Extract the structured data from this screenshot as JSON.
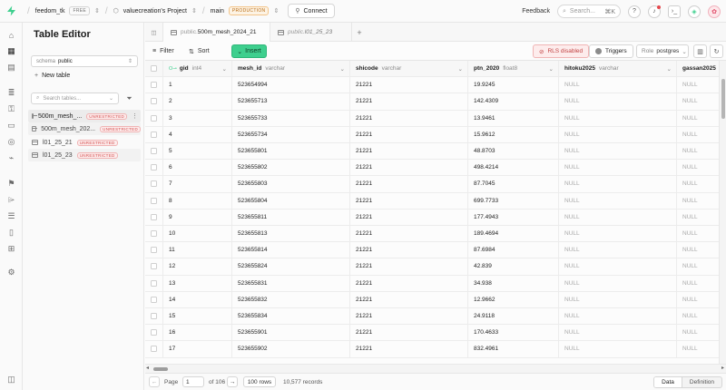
{
  "topbar": {
    "org": "feedom_tk",
    "org_plan": "FREE",
    "project": "valuecreation's Project",
    "branch": "main",
    "branch_env": "PRODUCTION",
    "connect_label": "Connect",
    "feedback_label": "Feedback",
    "search_placeholder": "Search...",
    "search_shortcut": "⌘K"
  },
  "sidebar": {
    "title": "Table Editor",
    "schema_label": "schema",
    "schema_value": "public",
    "new_table_label": "New table",
    "search_placeholder": "Search tables...",
    "tables": [
      {
        "name": "500m_mesh_...",
        "badge": "UNRESTRICTED",
        "state": "active"
      },
      {
        "name": "500m_mesh_202...",
        "badge": "UNRESTRICTED",
        "state": "hover"
      },
      {
        "name": "l01_25_21",
        "badge": "UNRESTRICTED",
        "state": ""
      },
      {
        "name": "l01_25_23",
        "badge": "UNRESTRICTED",
        "state": "hover"
      }
    ]
  },
  "tabs": [
    {
      "schema": "public.",
      "name": "500m_mesh_2024_21",
      "active": true
    },
    {
      "schema": "public.",
      "name": "l01_25_23",
      "active": false
    }
  ],
  "toolbar": {
    "filter_label": "Filter",
    "sort_label": "Sort",
    "insert_label": "Insert",
    "rls_label": "RLS disabled",
    "triggers_label": "Triggers",
    "role_label": "Role",
    "role_value": "postgres"
  },
  "columns": [
    {
      "name": "gid",
      "type": "int4",
      "key": true
    },
    {
      "name": "mesh_id",
      "type": "varchar",
      "key": false
    },
    {
      "name": "shicode",
      "type": "varchar",
      "key": false
    },
    {
      "name": "ptn_2020",
      "type": "float8",
      "key": false
    },
    {
      "name": "hitoku2025",
      "type": "varchar",
      "key": false
    },
    {
      "name": "gassan2025",
      "type": "v",
      "key": false
    }
  ],
  "rows": [
    [
      "1",
      "523654994",
      "21221",
      "19.9245",
      "NULL",
      "NULL"
    ],
    [
      "2",
      "523655713",
      "21221",
      "142.4309",
      "NULL",
      "NULL"
    ],
    [
      "3",
      "523655733",
      "21221",
      "13.9461",
      "NULL",
      "NULL"
    ],
    [
      "4",
      "523655734",
      "21221",
      "15.9612",
      "NULL",
      "NULL"
    ],
    [
      "5",
      "523655801",
      "21221",
      "48.8703",
      "NULL",
      "NULL"
    ],
    [
      "6",
      "523655802",
      "21221",
      "498.4214",
      "NULL",
      "NULL"
    ],
    [
      "7",
      "523655803",
      "21221",
      "87.7045",
      "NULL",
      "NULL"
    ],
    [
      "8",
      "523655804",
      "21221",
      "699.7733",
      "NULL",
      "NULL"
    ],
    [
      "9",
      "523655811",
      "21221",
      "177.4943",
      "NULL",
      "NULL"
    ],
    [
      "10",
      "523655813",
      "21221",
      "189.4694",
      "NULL",
      "NULL"
    ],
    [
      "11",
      "523655814",
      "21221",
      "87.6984",
      "NULL",
      "NULL"
    ],
    [
      "12",
      "523655824",
      "21221",
      "42.839",
      "NULL",
      "NULL"
    ],
    [
      "13",
      "523655831",
      "21221",
      "34.938",
      "NULL",
      "NULL"
    ],
    [
      "14",
      "523655832",
      "21221",
      "12.9662",
      "NULL",
      "NULL"
    ],
    [
      "15",
      "523655834",
      "21221",
      "24.9118",
      "NULL",
      "NULL"
    ],
    [
      "16",
      "523655901",
      "21221",
      "170.4633",
      "NULL",
      "NULL"
    ],
    [
      "17",
      "523655902",
      "21221",
      "832.4961",
      "NULL",
      "NULL"
    ]
  ],
  "footer": {
    "page_label": "Page",
    "page_value": "1",
    "page_total": "of 106",
    "rows_label": "100 rows",
    "records_label": "10,577 records",
    "view_data": "Data",
    "view_definition": "Definition"
  },
  "colors": {
    "brand": "#3ecf8e",
    "unrestricted": "#d45050",
    "production": "#b86b13"
  }
}
